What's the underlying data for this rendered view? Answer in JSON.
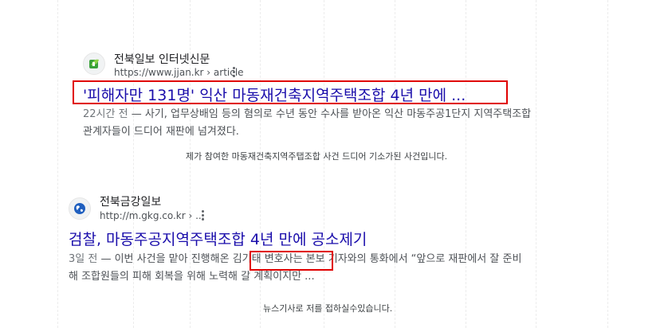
{
  "colors": {
    "title_link": "#1a0dab",
    "snippet_text": "#4d5156",
    "highlight_box": "#e00000"
  },
  "results": [
    {
      "site_name": "전북일보 인터넷신문",
      "url": "https://www.jjan.kr › article",
      "icon": "jjan-leaf-icon",
      "title": "'피해자만 131명' 익산 마동재건축지역주택조합 4년 만에 ...",
      "time": "22시간 전",
      "snippet_line1": " — 사기, 업무상배임 등의 혐의로 수년 동안 수사를 받아온 익산 마동주공1단지 지역주택조합",
      "snippet_line2": "관계자들이 드디어 재판에 넘겨졌다.",
      "note": "제가 참여한 마동재건축지역주탭조합 사건 드디어 기소가된 사건입니다."
    },
    {
      "site_name": "전북금강일보",
      "url": "http://m.gkg.co.kr › ...",
      "icon": "globe-icon",
      "title": "검찰, 마동주공지역주택조합 4년 만에 공소제기",
      "time": "3일 전",
      "snippet_pre": " — 이번 사건을 맡아 진행해온 ",
      "snippet_highlight": "김기태 변호사는",
      "snippet_post": " 본보 기자와의 통화에서 “앞으로 재판에서 잘 준비",
      "snippet_line2": "해 조합원들의 피해 회복을 위해 노력해 갈 계획이지만 ...",
      "note": "뉴스기사로 저를 접하실수있습니다."
    }
  ]
}
